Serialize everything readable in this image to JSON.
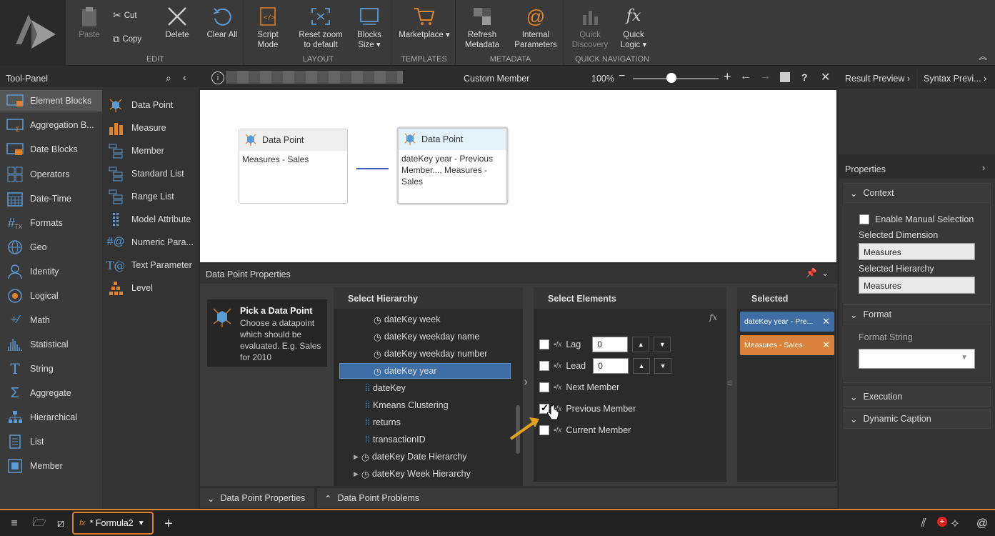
{
  "ribbon": {
    "edit": {
      "label": "EDIT",
      "paste": "Paste",
      "cut": "Cut",
      "copy": "Copy",
      "delete": "Delete",
      "clear_all": "Clear All"
    },
    "layout": {
      "label": "LAYOUT",
      "script_mode_1": "Script",
      "script_mode_2": "Mode",
      "reset_zoom_1": "Reset zoom",
      "reset_zoom_2": "to default",
      "blocks_size_1": "Blocks",
      "blocks_size_2": "Size ▾"
    },
    "templates": {
      "label": "TEMPLATES",
      "marketplace": "Marketplace ▾"
    },
    "metadata": {
      "label": "METADATA",
      "refresh_1": "Refresh",
      "refresh_2": "Metadata",
      "internal_1": "Internal",
      "internal_2": "Parameters"
    },
    "quick_nav": {
      "label": "QUICK NAVIGATION",
      "discovery_1": "Quick",
      "discovery_2": "Discovery",
      "logic_1": "Quick",
      "logic_2": "Logic ▾"
    }
  },
  "toolpanel": {
    "title": "Tool-Panel",
    "categories": [
      {
        "label": "Element Blocks"
      },
      {
        "label": "Aggregation B..."
      },
      {
        "label": "Date Blocks"
      },
      {
        "label": "Operators"
      },
      {
        "label": "Date-Time"
      },
      {
        "label": "Formats"
      },
      {
        "label": "Geo"
      },
      {
        "label": "Identity"
      },
      {
        "label": "Logical"
      },
      {
        "label": "Math"
      },
      {
        "label": "Statistical"
      },
      {
        "label": "String"
      },
      {
        "label": "Aggregate"
      },
      {
        "label": "Hierarchical"
      },
      {
        "label": "List"
      },
      {
        "label": "Member"
      }
    ],
    "blocks": [
      {
        "label": "Data Point"
      },
      {
        "label": "Measure"
      },
      {
        "label": "Member"
      },
      {
        "label": "Standard List"
      },
      {
        "label": "Range List"
      },
      {
        "label": "Model Attribute"
      },
      {
        "label": "Numeric Para..."
      },
      {
        "label": "Text Parameter"
      },
      {
        "label": "Level"
      }
    ]
  },
  "canvas_header": {
    "title": "Custom Member",
    "zoom": "100%"
  },
  "canvas": {
    "box1": {
      "title": "Data Point",
      "body": "Measures - Sales"
    },
    "box2": {
      "title": "Data Point",
      "body": "dateKey year - Previous Member..., Measures - Sales"
    }
  },
  "dp_properties": {
    "title": "Data Point Properties",
    "hint_title": "Pick a Data Point",
    "hint_body": "Choose a datapoint which should be evaluated. E.g. Sales for 2010",
    "hierarchy": {
      "title": "Select Hierarchy",
      "items": [
        {
          "label": "dateKey week"
        },
        {
          "label": "dateKey weekday name"
        },
        {
          "label": "dateKey weekday number"
        },
        {
          "label": "dateKey year"
        },
        {
          "label": "dateKey"
        },
        {
          "label": "Kmeans Clustering"
        },
        {
          "label": "returns"
        },
        {
          "label": "transactionID"
        },
        {
          "label": "dateKey Date Hierarchy"
        },
        {
          "label": "dateKey Week Hierarchy"
        }
      ]
    },
    "elements": {
      "title": "Select Elements",
      "lag_label": "Lag",
      "lag_value": "0",
      "lead_label": "Lead",
      "lead_value": "0",
      "next": "Next Member",
      "previous": "Previous Member",
      "current": "Current Member"
    },
    "selected": {
      "title": "Selected",
      "chip1": "dateKey year - Pre...",
      "chip2": "Measures - Sales"
    }
  },
  "bottom_tabs": {
    "tab1": "Data Point Properties",
    "tab2": "Data Point Problems"
  },
  "right_panel": {
    "result_preview": "Result Preview",
    "syntax_preview": "Syntax Previ...",
    "properties_title": "Properties",
    "context": "Context",
    "enable_manual": "Enable Manual Selection",
    "selected_dimension_label": "Selected Dimension",
    "selected_dimension": "Measures",
    "selected_hierarchy_label": "Selected Hierarchy",
    "selected_hierarchy": "Measures",
    "format": "Format",
    "format_string": "Format String",
    "execution": "Execution",
    "dynamic_caption": "Dynamic Caption"
  },
  "taskbar": {
    "tab_label": "* Formula2"
  }
}
